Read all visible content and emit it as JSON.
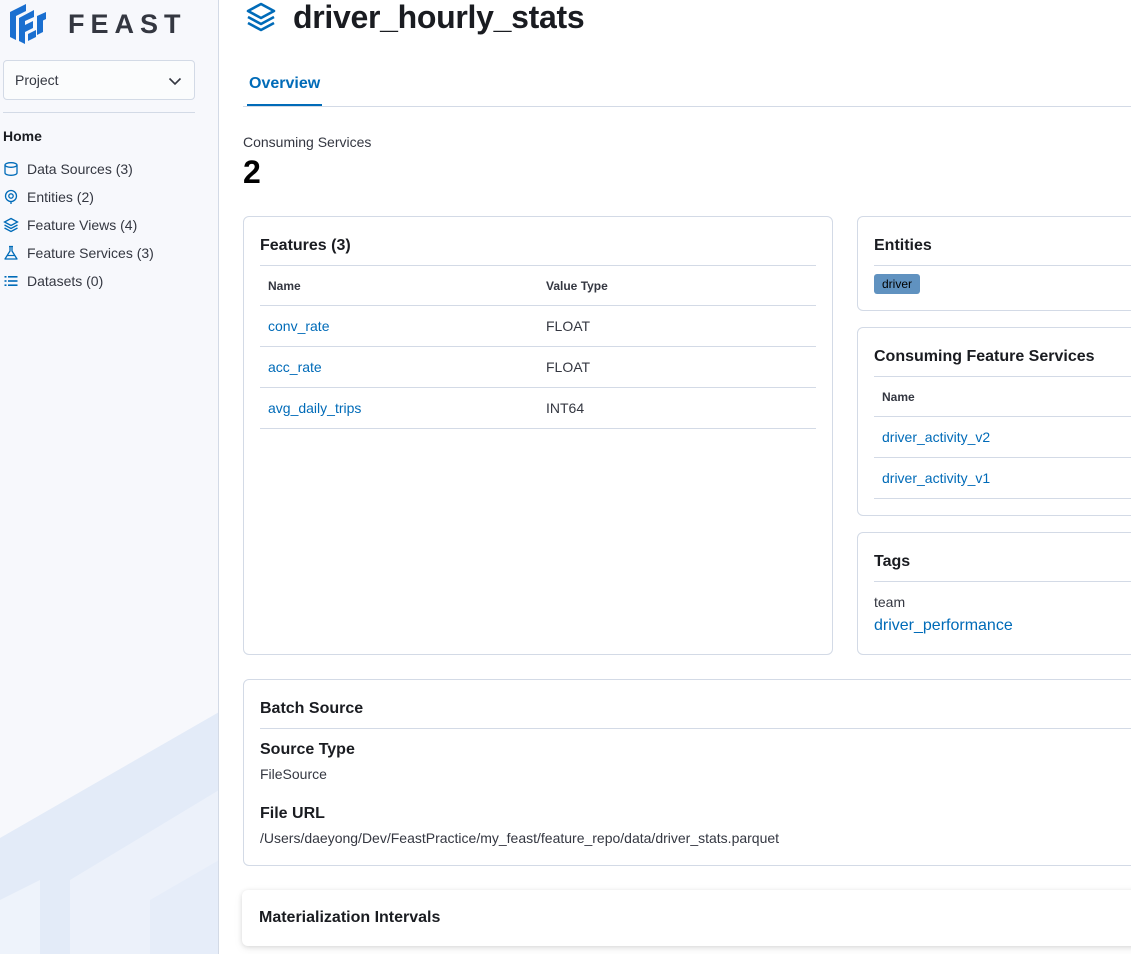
{
  "brand": {
    "logo_text": "FEAST"
  },
  "sidebar": {
    "project_select": {
      "value": "Project"
    },
    "home_label": "Home",
    "items": [
      {
        "label": "Data Sources (3)",
        "icon": "database-icon"
      },
      {
        "label": "Entities (2)",
        "icon": "entity-icon"
      },
      {
        "label": "Feature Views (4)",
        "icon": "layers-icon"
      },
      {
        "label": "Feature Services (3)",
        "icon": "flask-icon"
      },
      {
        "label": "Datasets (0)",
        "icon": "list-icon"
      }
    ]
  },
  "page": {
    "title": "driver_hourly_stats",
    "tabs": [
      {
        "label": "Overview",
        "active": true
      }
    ]
  },
  "stat": {
    "label": "Consuming Services",
    "value": "2"
  },
  "features": {
    "title": "Features (3)",
    "columns": [
      "Name",
      "Value Type"
    ],
    "rows": [
      {
        "name": "conv_rate",
        "type": "FLOAT"
      },
      {
        "name": "acc_rate",
        "type": "FLOAT"
      },
      {
        "name": "avg_daily_trips",
        "type": "INT64"
      }
    ]
  },
  "entities": {
    "title": "Entities",
    "badges": [
      "driver"
    ]
  },
  "consuming_feature_services": {
    "title": "Consuming Feature Services",
    "columns": [
      "Name"
    ],
    "rows": [
      "driver_activity_v2",
      "driver_activity_v1"
    ]
  },
  "tags": {
    "title": "Tags",
    "key": "team",
    "value": "driver_performance"
  },
  "batch_source": {
    "title": "Batch Source",
    "source_type_label": "Source Type",
    "source_type_value": "FileSource",
    "file_url_label": "File URL",
    "file_url_value": "/Users/daeyong/Dev/FeastPractice/my_feast/feature_repo/data/driver_stats.parquet"
  },
  "materialization": {
    "title": "Materialization Intervals"
  },
  "colors": {
    "accent": "#006bb8",
    "badge": "#6092c0",
    "border": "#d3dae6",
    "sidebar_bg": "#f7f8fc"
  }
}
